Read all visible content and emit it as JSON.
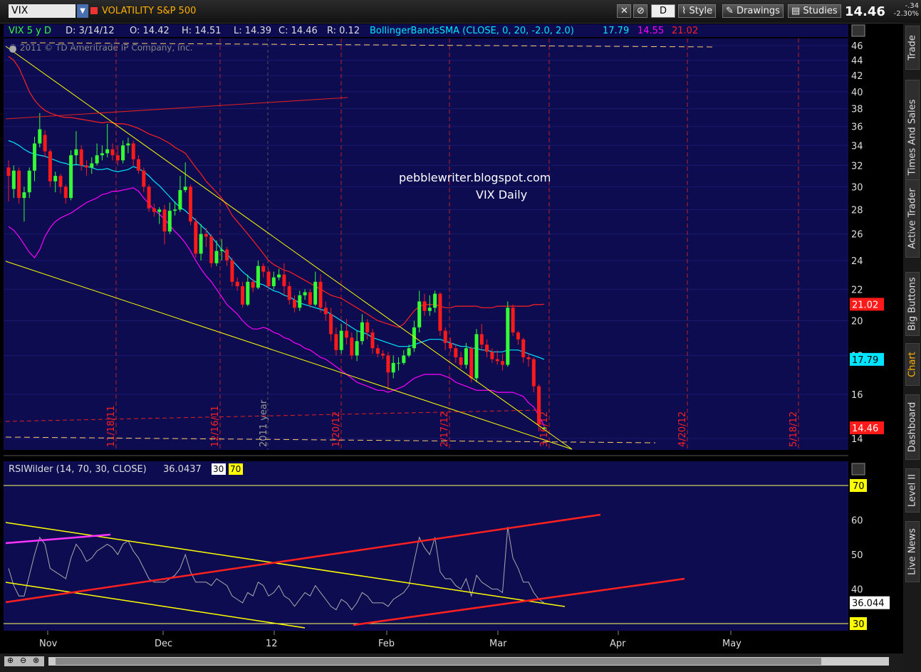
{
  "toolbar": {
    "symbol": "VIX",
    "description": "VOLATILITY S&P 500",
    "aggregation": "D",
    "style_label": "Style",
    "drawings_label": "Drawings",
    "studies_label": "Studies",
    "last": "14.46",
    "net_change": "-.34",
    "pct_change": "-2.30%"
  },
  "side_tabs": [
    "Trade",
    "Times And Sales",
    "Active Trader",
    "Big Buttons",
    "Chart",
    "Dashboard",
    "Level II",
    "Live News"
  ],
  "active_tab": "Chart",
  "header": {
    "symbol": "VIX 5 y D",
    "date": "D: 3/14/12",
    "open": "O: 14.42",
    "high": "H: 14.51",
    "low": "L: 14.39",
    "close": "C: 14.46",
    "range": "R: 0.12",
    "study": "BollingerBandsSMA (CLOSE, 0, 20, -2.0, 2.0)",
    "bb_mid": "17.79",
    "bb_low": "14.55",
    "bb_high": "21.02",
    "copyright": "© 2011 © TD Ameritrade IP Company, Inc."
  },
  "annotations": {
    "line1": "pebblewriter.blogspot.com",
    "line2": "VIX Daily",
    "year_label": "2011 year",
    "expiry_labels": [
      "11/18/11",
      "12/16/11",
      "1/20/12",
      "2/17/12",
      "3/16/12",
      "4/20/12",
      "5/18/12"
    ]
  },
  "rsi_header": {
    "study": "RSIWilder (14, 70, 30, CLOSE)",
    "value": "36.0437",
    "ob": "30",
    "os": "70"
  },
  "colors": {
    "up": "#33ff33",
    "down": "#ff1a1a",
    "mid": "#00e5ff",
    "upper": "#ff2020",
    "lower": "#ff00ff",
    "trend": "#ffff00",
    "bg": "#0d0c50"
  },
  "chart_data": [
    {
      "type": "candlestick",
      "title": "VIX Daily",
      "ylim": [
        13.3,
        46.5
      ],
      "y_ticks": [
        14,
        16,
        18,
        20,
        22,
        24,
        26,
        28,
        30,
        32,
        34,
        36,
        38,
        40,
        42,
        44,
        46
      ],
      "x_ticks": [
        "Nov",
        "Dec",
        "12",
        "Feb",
        "Mar",
        "Apr",
        "May"
      ],
      "price_labels": [
        {
          "value": 21.02,
          "label": "21.02",
          "color": "#ff1a1a"
        },
        {
          "value": 17.79,
          "label": "17.79",
          "color": "#00e5ff"
        },
        {
          "value": 14.46,
          "label": "14.46",
          "color": "#ff1a1a"
        }
      ],
      "candles": [
        [
          31.8,
          31.0,
          32.5,
          28.7
        ],
        [
          29.8,
          31.5,
          32.0,
          29.0
        ],
        [
          31.5,
          29.0,
          31.8,
          28.5
        ],
        [
          29.0,
          29.5,
          30.0,
          27.0
        ],
        [
          29.5,
          31.5,
          31.8,
          29.0
        ],
        [
          31.5,
          34.2,
          34.9,
          30.5
        ],
        [
          34.2,
          35.7,
          37.5,
          33.8
        ],
        [
          35.1,
          33.4,
          35.6,
          32.8
        ],
        [
          33.4,
          30.5,
          33.6,
          30.0
        ],
        [
          30.5,
          31.0,
          31.4,
          29.5
        ],
        [
          31.0,
          30.0,
          31.2,
          29.4
        ],
        [
          30.0,
          29.0,
          30.2,
          28.5
        ],
        [
          29.0,
          33.0,
          33.5,
          28.8
        ],
        [
          33.0,
          33.6,
          35.5,
          32.0
        ],
        [
          33.6,
          32.0,
          34.0,
          31.5
        ],
        [
          32.0,
          31.8,
          32.5,
          31.0
        ],
        [
          31.8,
          32.2,
          32.8,
          31.2
        ],
        [
          32.2,
          33.0,
          34.2,
          32.0
        ],
        [
          33.0,
          33.2,
          34.0,
          32.5
        ],
        [
          33.2,
          33.6,
          36.3,
          32.8
        ],
        [
          33.6,
          33.0,
          34.2,
          32.5
        ],
        [
          33.0,
          32.5,
          34.0,
          32.0
        ],
        [
          32.5,
          34.0,
          34.5,
          32.2
        ],
        [
          34.0,
          34.2,
          34.8,
          33.2
        ],
        [
          34.2,
          32.6,
          34.5,
          32.0
        ],
        [
          32.6,
          31.5,
          33.0,
          31.2
        ],
        [
          31.5,
          30.0,
          31.8,
          29.5
        ],
        [
          30.0,
          28.1,
          30.2,
          27.8
        ],
        [
          28.1,
          27.8,
          28.5,
          27.4
        ],
        [
          27.8,
          28.0,
          28.2,
          26.8
        ],
        [
          28.0,
          26.2,
          28.4,
          25.2
        ],
        [
          26.2,
          27.9,
          28.6,
          26.0
        ],
        [
          27.9,
          28.0,
          28.7,
          27.5
        ],
        [
          28.0,
          29.7,
          31.0,
          27.8
        ],
        [
          29.7,
          30.0,
          32.3,
          29.5
        ],
        [
          30.0,
          27.0,
          30.2,
          26.7
        ],
        [
          27.0,
          24.5,
          27.3,
          24.2
        ],
        [
          24.5,
          26.0,
          26.8,
          24.0
        ],
        [
          26.0,
          25.8,
          26.5,
          25.0
        ],
        [
          25.8,
          23.8,
          26.0,
          23.5
        ],
        [
          23.8,
          24.7,
          25.5,
          23.6
        ],
        [
          24.7,
          24.8,
          25.6,
          24.0
        ],
        [
          24.8,
          24.0,
          25.0,
          23.6
        ],
        [
          24.0,
          22.5,
          24.2,
          22.2
        ],
        [
          22.5,
          22.2,
          22.8,
          21.9
        ],
        [
          22.2,
          21.0,
          22.5,
          20.8
        ],
        [
          21.0,
          22.5,
          23.0,
          20.9
        ],
        [
          22.5,
          22.1,
          22.7,
          21.8
        ],
        [
          22.1,
          23.6,
          24.0,
          22.0
        ],
        [
          23.6,
          23.2,
          23.8,
          22.8
        ],
        [
          23.2,
          22.2,
          23.4,
          22.0
        ],
        [
          22.2,
          22.8,
          23.2,
          22.0
        ],
        [
          22.8,
          23.0,
          23.4,
          22.6
        ],
        [
          23.0,
          22.2,
          23.8,
          21.6
        ],
        [
          22.2,
          21.3,
          22.5,
          21.0
        ],
        [
          21.3,
          20.8,
          21.6,
          20.5
        ],
        [
          20.8,
          21.6,
          21.9,
          20.6
        ],
        [
          21.6,
          21.8,
          22.0,
          21.3
        ],
        [
          21.8,
          21.0,
          22.0,
          20.8
        ],
        [
          21.0,
          22.5,
          23.2,
          20.9
        ],
        [
          22.5,
          20.8,
          23.0,
          20.5
        ],
        [
          20.8,
          20.4,
          21.2,
          20.0
        ],
        [
          20.4,
          19.2,
          20.8,
          18.8
        ],
        [
          19.2,
          18.3,
          19.6,
          18.0
        ],
        [
          18.3,
          19.4,
          19.8,
          18.1
        ],
        [
          19.4,
          19.0,
          20.1,
          18.6
        ],
        [
          19.0,
          18.0,
          19.3,
          17.8
        ],
        [
          18.0,
          18.8,
          19.4,
          17.7
        ],
        [
          18.8,
          19.9,
          20.4,
          18.6
        ],
        [
          19.9,
          19.3,
          20.1,
          18.9
        ],
        [
          19.3,
          18.4,
          19.5,
          18.1
        ],
        [
          18.4,
          18.1,
          18.6,
          17.9
        ],
        [
          18.1,
          18.0,
          18.3,
          17.8
        ],
        [
          18.0,
          17.1,
          18.2,
          16.2
        ],
        [
          17.1,
          17.6,
          18.0,
          16.8
        ],
        [
          17.6,
          17.6,
          17.9,
          17.2
        ],
        [
          17.6,
          18.0,
          18.3,
          17.5
        ],
        [
          18.0,
          18.4,
          18.6,
          17.9
        ],
        [
          18.4,
          19.6,
          20.0,
          18.2
        ],
        [
          19.6,
          21.2,
          21.9,
          19.3
        ],
        [
          21.2,
          20.6,
          21.7,
          20.3
        ],
        [
          20.6,
          20.8,
          21.6,
          20.3
        ],
        [
          20.8,
          21.7,
          21.9,
          20.5
        ],
        [
          21.7,
          19.4,
          21.8,
          19.1
        ],
        [
          19.4,
          18.7,
          19.6,
          18.3
        ],
        [
          18.7,
          18.4,
          19.0,
          18.2
        ],
        [
          18.4,
          17.9,
          18.6,
          17.6
        ],
        [
          17.9,
          17.5,
          18.2,
          17.3
        ],
        [
          17.5,
          18.4,
          18.7,
          17.3
        ],
        [
          18.4,
          16.8,
          18.5,
          16.6
        ],
        [
          16.8,
          19.2,
          19.5,
          16.6
        ],
        [
          19.2,
          18.6,
          19.8,
          18.3
        ],
        [
          18.6,
          18.2,
          18.9,
          17.9
        ],
        [
          18.2,
          17.8,
          18.4,
          17.6
        ],
        [
          17.8,
          17.7,
          18.3,
          17.5
        ],
        [
          17.7,
          17.5,
          18.1,
          17.2
        ],
        [
          17.5,
          20.8,
          21.2,
          17.4
        ],
        [
          20.8,
          19.3,
          21.0,
          19.1
        ],
        [
          19.3,
          18.9,
          19.4,
          18.6
        ],
        [
          18.9,
          17.9,
          19.0,
          17.6
        ],
        [
          17.9,
          17.8,
          18.1,
          17.4
        ],
        [
          17.8,
          16.4,
          17.9,
          16.1
        ],
        [
          16.4,
          14.6,
          16.5,
          14.3
        ],
        [
          14.42,
          14.46,
          14.51,
          14.39
        ]
      ],
      "bb_mid": [
        34.5,
        34.3,
        34.0,
        33.6,
        33.3,
        33.1,
        33.0,
        32.9,
        32.7,
        32.5,
        32.3,
        32.2,
        32.0,
        32.1,
        32.0,
        31.9,
        31.8,
        31.6,
        31.6,
        31.7,
        31.5,
        31.4,
        31.5,
        31.6,
        31.9,
        31.7,
        31.4,
        31.0,
        30.5,
        30.1,
        29.6,
        29.1,
        28.6,
        28.2,
        27.9,
        27.5,
        27.1,
        26.7,
        26.3,
        25.8,
        25.3,
        24.8,
        24.5,
        24.0,
        23.6,
        23.2,
        22.9,
        22.6,
        22.4,
        22.3,
        22.1,
        21.9,
        21.8,
        21.6,
        21.5,
        21.3,
        21.1,
        21.0,
        20.9,
        20.8,
        20.7,
        20.6,
        20.4,
        20.2,
        20.0,
        19.8,
        19.6,
        19.4,
        19.3,
        19.2,
        19.0,
        18.9,
        18.8,
        18.7,
        18.6,
        18.5,
        18.5,
        18.5,
        18.6,
        18.7,
        18.8,
        18.9,
        18.9,
        18.9,
        18.8,
        18.7,
        18.6,
        18.5,
        18.5,
        18.4,
        18.4,
        18.3,
        18.3,
        18.2,
        18.2,
        18.2,
        18.3,
        18.3,
        18.3,
        18.2,
        18.1,
        18.0,
        17.9,
        17.79
      ],
      "bb_upper": [
        44.5,
        44.0,
        43.0,
        41.5,
        40.0,
        39.0,
        38.3,
        37.8,
        37.5,
        37.3,
        37.1,
        37.0,
        37.0,
        36.9,
        36.8,
        36.7,
        36.6,
        36.5,
        36.4,
        36.5,
        36.4,
        36.3,
        36.3,
        36.2,
        36.0,
        35.8,
        35.5,
        35.2,
        35.0,
        34.8,
        34.5,
        34.2,
        33.8,
        33.5,
        33.2,
        32.5,
        31.8,
        31.2,
        30.5,
        30.0,
        29.5,
        29.0,
        28.3,
        27.5,
        27.0,
        26.5,
        26.0,
        25.5,
        25.0,
        24.5,
        24.0,
        23.7,
        23.5,
        23.3,
        23.2,
        23.0,
        22.8,
        22.6,
        22.4,
        22.2,
        22.0,
        21.8,
        21.6,
        21.5,
        21.4,
        21.2,
        21.0,
        20.8,
        20.6,
        20.4,
        20.2,
        20.0,
        19.9,
        19.8,
        19.7,
        19.6,
        19.8,
        20.2,
        20.6,
        20.9,
        21.0,
        21.0,
        21.0,
        20.9,
        20.8,
        20.8,
        20.9,
        20.9,
        20.9,
        20.9,
        20.9,
        20.8,
        20.8,
        20.8,
        20.9,
        20.9,
        20.9,
        20.9,
        20.9,
        20.9,
        20.9,
        21.0,
        21.0,
        21.02
      ],
      "bb_lower": [
        26.6,
        26.3,
        25.8,
        25.2,
        24.6,
        24.2,
        24.8,
        25.8,
        26.5,
        27.0,
        27.3,
        27.5,
        27.7,
        28.0,
        28.3,
        28.6,
        28.8,
        29.0,
        29.3,
        29.4,
        29.6,
        29.6,
        29.7,
        29.8,
        29.9,
        29.6,
        29.0,
        28.5,
        28.0,
        27.6,
        27.2,
        26.7,
        26.2,
        25.8,
        25.3,
        24.7,
        24.0,
        23.4,
        22.9,
        22.5,
        22.0,
        21.5,
        21.0,
        20.7,
        20.4,
        20.0,
        19.7,
        19.5,
        19.5,
        19.6,
        19.5,
        19.3,
        19.2,
        19.0,
        18.9,
        18.7,
        18.6,
        18.4,
        18.3,
        18.1,
        17.9,
        17.8,
        17.6,
        17.4,
        17.2,
        17.0,
        16.8,
        16.6,
        16.5,
        16.4,
        16.3,
        16.2,
        16.2,
        16.1,
        16.2,
        16.3,
        16.4,
        16.6,
        16.8,
        16.9,
        17.0,
        17.0,
        17.0,
        17.0,
        16.9,
        16.8,
        16.6,
        16.5,
        16.4,
        16.3,
        16.2,
        16.2,
        16.2,
        16.2,
        16.1,
        16.1,
        16.1,
        16.1,
        16.0,
        15.9,
        15.6,
        15.4,
        15.0,
        14.55
      ]
    },
    {
      "type": "line",
      "title": "RSIWilder (14, 70, 30, CLOSE)",
      "ylim": [
        28,
        72
      ],
      "y_ticks": [
        30,
        40,
        50,
        60,
        70
      ],
      "overbought": 70,
      "oversold": 30,
      "last_value": "36.044",
      "series": [
        {
          "values": [
            46,
            41,
            38,
            38,
            44,
            50,
            55,
            53,
            46,
            45,
            44,
            43,
            49,
            53,
            51,
            48,
            49,
            51,
            52,
            53,
            52,
            50,
            53,
            54,
            51,
            49,
            46,
            43,
            42,
            42,
            42,
            43,
            44,
            46,
            50,
            45,
            42,
            42,
            42,
            41,
            43,
            42,
            41,
            38,
            37,
            36,
            39,
            38,
            42,
            41,
            38,
            39,
            41,
            38,
            37,
            35,
            37,
            39,
            38,
            41,
            39,
            37,
            35,
            34,
            37,
            36,
            34,
            36,
            39,
            38,
            36,
            36,
            36,
            35,
            37,
            38,
            39,
            41,
            48,
            55,
            52,
            50,
            55,
            45,
            43,
            43,
            41,
            40,
            43,
            38,
            44,
            42,
            41,
            40,
            40,
            39,
            58,
            49,
            46,
            42,
            42,
            39,
            37,
            36
          ]
        }
      ]
    }
  ]
}
